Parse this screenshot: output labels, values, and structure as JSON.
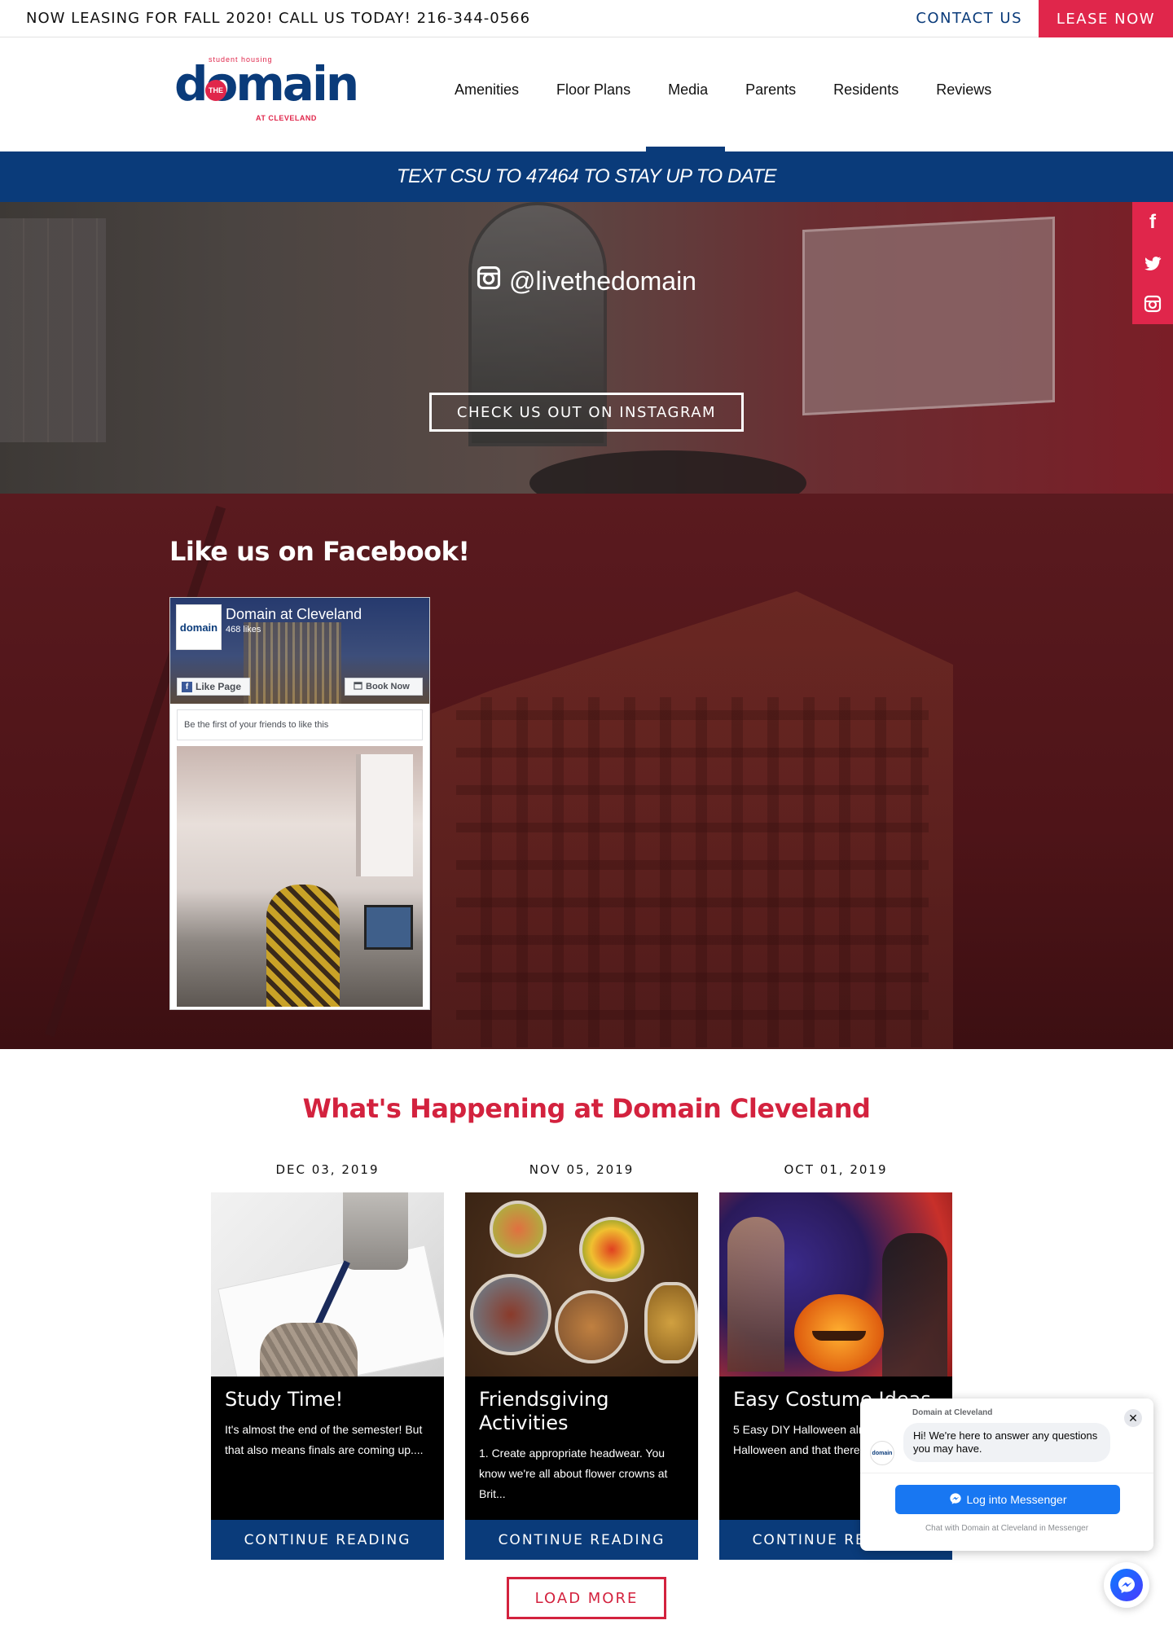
{
  "topbar": {
    "message": "NOW LEASING FOR FALL 2020! CALL US TODAY! 216-344-0566",
    "contact_label": "CONTACT US",
    "lease_label": "LEASE NOW"
  },
  "logo": {
    "tagline": "student housing",
    "the": "THE",
    "word": "domain",
    "sub": "AT CLEVELAND"
  },
  "nav": [
    "Amenities",
    "Floor Plans",
    "Media",
    "Parents",
    "Residents",
    "Reviews"
  ],
  "banner": "TEXT CSU TO 47464 TO STAY UP TO DATE",
  "instagram": {
    "handle": "@livethedomain",
    "cta": "CHECK US OUT ON INSTAGRAM"
  },
  "social": {
    "facebook_glyph": "f",
    "icons": [
      "facebook-icon",
      "twitter-icon",
      "instagram-icon"
    ]
  },
  "facebook": {
    "title": "Like us on Facebook!",
    "page_logo": "domain",
    "page_name": "Domain at Cleveland",
    "likes": "468 likes",
    "like_button": "Like Page",
    "book_button": "Book Now",
    "first_friend": "Be the first of your friends to like this"
  },
  "events": {
    "title": "What's Happening at Domain Cleveland",
    "posts": [
      {
        "date": "DEC 03, 2019",
        "title": "Study Time!",
        "excerpt": "It's almost the end of the semester! But that also means finals are coming up....",
        "more": "CONTINUE READING"
      },
      {
        "date": "NOV 05, 2019",
        "title": "Friendsgiving Activities",
        "excerpt": "1. Create appropriate headwear. You know we're all about flower crowns at Brit...",
        "more": "CONTINUE READING"
      },
      {
        "date": "OCT 01, 2019",
        "title": "Easy Costume Ideas",
        "excerpt": "5 Easy DIY Halloween almost Halloween and that there are...",
        "more": "CONTINUE READING"
      }
    ],
    "load_more": "LOAD MORE"
  },
  "messenger": {
    "page_name": "Domain at Cleveland",
    "avatar_label": "domain",
    "close_glyph": "✕",
    "greeting": "Hi! We're here to answer any questions you may have.",
    "login_label": "Log into Messenger",
    "footer": "Chat with Domain at Cleveland in Messenger"
  },
  "colors": {
    "brand_blue": "#0a3b7a",
    "brand_red": "#e0264b",
    "heading_red": "#d3223e",
    "messenger_blue": "#1877f2"
  }
}
